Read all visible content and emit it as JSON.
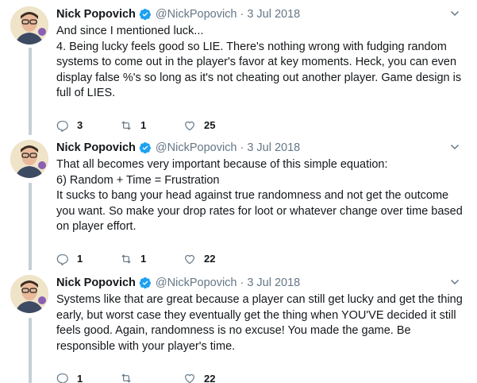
{
  "tweets": [
    {
      "author_name": "Nick Popovich",
      "handle": "@NickPopovich",
      "separator": "·",
      "date": "3 Jul 2018",
      "text": "And since I mentioned luck...\n4. Being lucky feels good so LIE. There's nothing wrong with fudging random systems to come out in the player's favor at key moments. Heck, you can even display false %'s so long as it's not cheating out another player. Game design is full of LIES.",
      "replies": "3",
      "retweets": "1",
      "likes": "25"
    },
    {
      "author_name": "Nick Popovich",
      "handle": "@NickPopovich",
      "separator": "·",
      "date": "3 Jul 2018",
      "text": "That all becomes very important because of this simple equation:\n6) Random + Time = Frustration\nIt sucks to bang your head against true randomness and not get the outcome you want. So make your drop rates for loot or whatever change over time based on player effort.",
      "replies": "1",
      "retweets": "1",
      "likes": "22"
    },
    {
      "author_name": "Nick Popovich",
      "handle": "@NickPopovich",
      "separator": "·",
      "date": "3 Jul 2018",
      "text": "Systems like that are great because a player can still get lucky and get the thing early, but worst case they eventually get the thing when YOU'VE decided it still feels good. Again, randomness is no excuse! You made the game. Be responsible with your player's time.",
      "replies": "1",
      "retweets": "",
      "likes": "22"
    }
  ],
  "icons": {
    "verified": "verified-badge-icon",
    "reply": "reply-icon",
    "retweet": "retweet-icon",
    "like": "heart-icon",
    "menu": "chevron-down-icon"
  },
  "colors": {
    "verified": "#1da1f2",
    "muted": "#657786",
    "thread_line": "#c4cfd6"
  }
}
